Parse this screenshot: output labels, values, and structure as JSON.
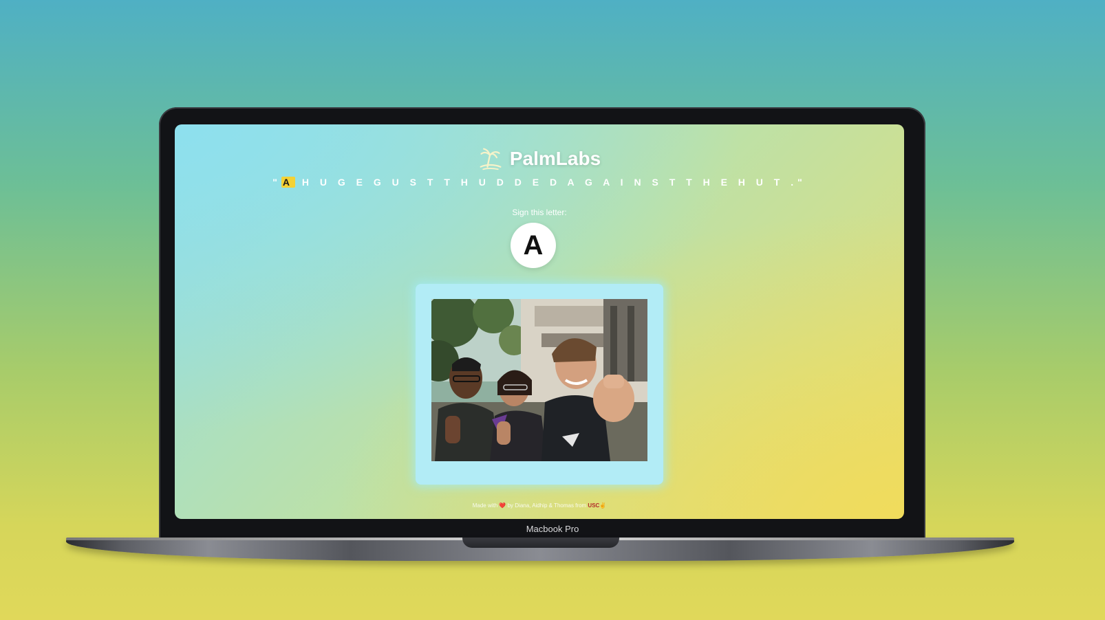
{
  "app": {
    "brand_name": "PalmLabs",
    "brand_icon": "palm-tree-island-icon",
    "phrase_open_quote": "\"",
    "phrase_active_letter": "A",
    "phrase_rest": " H U G E  G U S T  T H U D D E D  A G A I N S T  T H E  H U T .",
    "phrase_close_quote": "\"",
    "sign_label": "Sign this letter:",
    "current_letter": "A",
    "footer": {
      "made_with": "Made with",
      "heart": "❤️",
      "by": "by Diana, Aidhip & Thomas from",
      "school": "USC",
      "trojan": "✌"
    }
  },
  "device": {
    "model_label": "Macbook Pro"
  },
  "colors": {
    "highlight": "#f4d234",
    "frame": "#b2ecf6",
    "usc": "#b22a2a"
  }
}
